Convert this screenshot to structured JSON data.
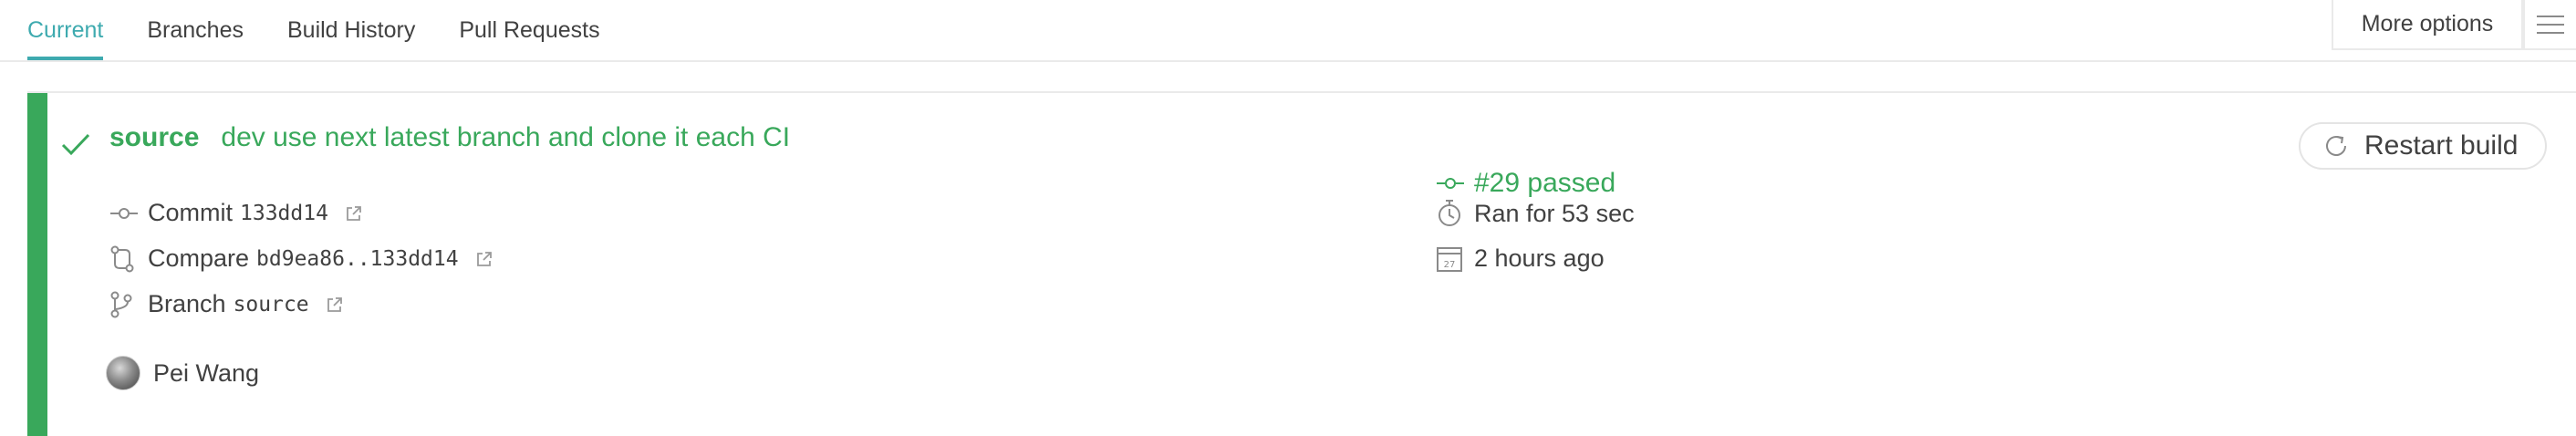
{
  "tabs": [
    {
      "label": "Current",
      "active": true
    },
    {
      "label": "Branches",
      "active": false
    },
    {
      "label": "Build History",
      "active": false
    },
    {
      "label": "Pull Requests",
      "active": false
    }
  ],
  "toolbar": {
    "more_options_label": "More options",
    "menu_icon": "hamburger-menu-icon"
  },
  "build": {
    "status_color": "#39a85b",
    "repo_label": "source",
    "commit_message": "dev use next latest branch and clone it each CI",
    "number_status": "#29 passed",
    "commit_label": "Commit",
    "commit_sha": "133dd14",
    "compare_label": "Compare",
    "compare_range": "bd9ea86..133dd14",
    "branch_label": "Branch",
    "branch_name": "source",
    "duration": "Ran for 53 sec",
    "finished": "2 hours ago",
    "calendar_day": "27",
    "author": "Pei Wang",
    "restart_label": "Restart build"
  },
  "colors": {
    "accent": "#3eaaaf",
    "passed": "#39a85b",
    "text": "#414141"
  }
}
